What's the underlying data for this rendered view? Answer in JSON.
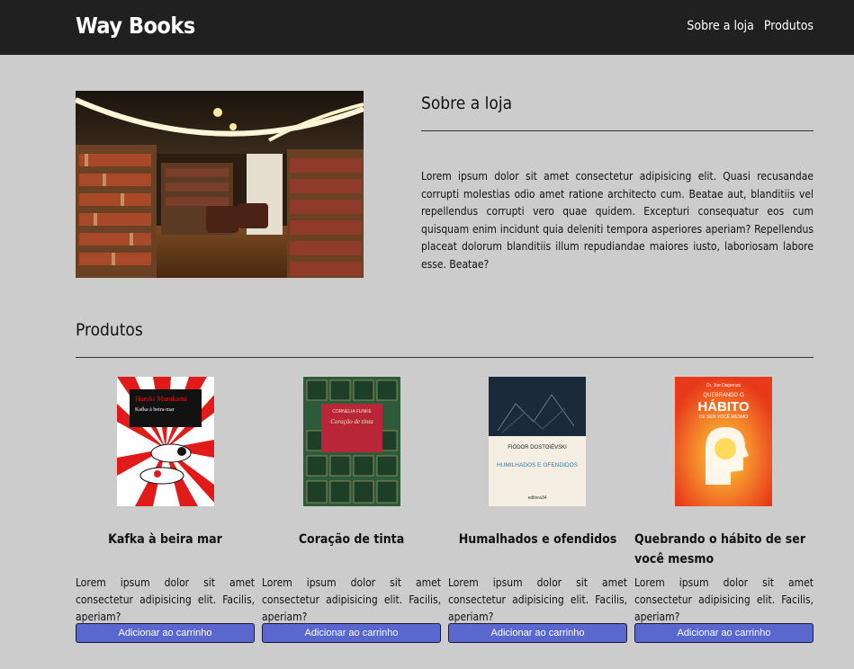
{
  "header": {
    "brand": "Way Books",
    "nav": [
      "Sobre a loja",
      "Produtos"
    ]
  },
  "about": {
    "image_icon": "bookstore-interior-image",
    "title": "Sobre a loja",
    "text": "Lorem ipsum dolor sit amet consectetur adipisicing elit. Quasi recusandae corrupti molestias odio amet ratione architecto cum. Beatae aut, blanditiis vel repellendus corrupti vero quae quidem. Excepturi consequatur eos cum quisquam enim incidunt quia deleniti tempora asperiores aperiam? Repellendus placeat dolorum blanditiis illum repudiandae maiores iusto, laboriosam labore esse. Beatae?"
  },
  "products": {
    "title": "Produtos",
    "items": [
      {
        "title": "Kafka à beira mar",
        "cover": {
          "author": "Haruki Murakami",
          "title": "Kafka à beira-mar"
        },
        "description": "Lorem ipsum dolor sit amet consectetur adipisicing elit. Facilis, aperiam?",
        "button": "Adicionar ao carrinho"
      },
      {
        "title": "Coração de tinta",
        "cover": {
          "author": "CORNELIA FUNKE",
          "title": "Coração de tinta"
        },
        "description": "Lorem ipsum dolor sit amet consectetur adipisicing elit. Facilis, aperiam?",
        "button": "Adicionar ao carrinho"
      },
      {
        "title": "Humalhados e ofendidos",
        "cover": {
          "author": "FIÓDOR DOSTOIÉVSKI",
          "title": "HUMILHADOS E OFENDIDOS",
          "publisher": "editora34"
        },
        "description": "Lorem ipsum dolor sit amet consectetur adipisicing elit. Facilis, aperiam?",
        "button": "Adicionar ao carrinho"
      },
      {
        "title": "Quebrando o hábito de ser você mesmo",
        "cover": {
          "author": "Dr. Joe Dispenza",
          "title_top": "QUEBRANDO O",
          "title_main": "HÁBITO",
          "title_bottom": "DE SER VOCÊ MESMO"
        },
        "description": "Lorem ipsum dolor sit amet consectetur adipisicing elit. Facilis, aperiam?",
        "button": "Adicionar ao carrinho"
      }
    ]
  },
  "colors": {
    "navbar": "#202020",
    "page_background": "#cccccc",
    "button": "#5a67cf"
  }
}
